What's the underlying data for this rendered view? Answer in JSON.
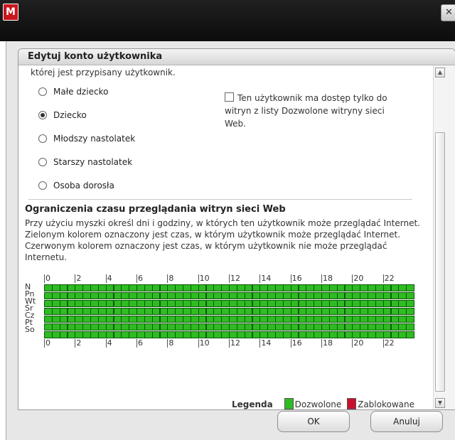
{
  "window": {
    "logo_letter": "M",
    "close_glyph": "✕"
  },
  "panel": {
    "title": "Edytuj konto użytkownika",
    "hint": "której jest przypisany użytkownik."
  },
  "age_groups": {
    "options": [
      {
        "label": "Małe dziecko",
        "checked": false
      },
      {
        "label": "Dziecko",
        "checked": true
      },
      {
        "label": "Młodszy nastolatek",
        "checked": false
      },
      {
        "label": "Starszy nastolatek",
        "checked": false
      },
      {
        "label": "Osoba dorosła",
        "checked": false
      }
    ]
  },
  "whitelist": {
    "label": "Ten użytkownik ma dostęp tylko do witryn z listy Dozwolone witryny sieci Web.",
    "checked": false
  },
  "time_limits": {
    "title": "Ograniczenia czasu przeglądania witryn sieci Web",
    "description": "Przy użyciu myszki określ dni i godziny, w których ten użytkownik może przeglądać Internet. Zielonym kolorem oznaczony jest czas, w którym użytkownik może przeglądać Internet. Czerwonym kolorem oznaczony jest czas, w którym użytkownik nie może przeglądać Internetu.",
    "days": [
      "N",
      "Pn",
      "Wt",
      "Śr",
      "Cz",
      "Pt",
      "So"
    ],
    "hour_labels": [
      "0",
      "2",
      "4",
      "6",
      "8",
      "10",
      "12",
      "14",
      "16",
      "18",
      "20",
      "22"
    ],
    "slots_per_day": 48,
    "allowed_fraction": 1,
    "colors": {
      "allowed": "#2fbb22",
      "blocked": "#c8102e"
    }
  },
  "legend": {
    "title": "Legenda",
    "allowed": "Dozwolone",
    "blocked": "Zablokowane"
  },
  "buttons": {
    "ok": "OK",
    "cancel": "Anuluj"
  },
  "scrollbar": {
    "up_glyph": "▲",
    "down_glyph": "▼"
  }
}
